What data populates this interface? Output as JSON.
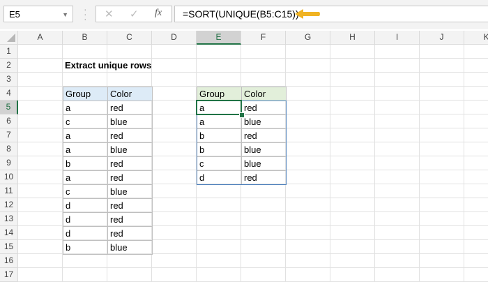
{
  "formula_bar": {
    "name_box": "E5",
    "cancel_icon": "✕",
    "enter_icon": "✓",
    "fx_label": "fx",
    "formula": "=SORT(UNIQUE(B5:C15))",
    "arrow_color": "#f0b323"
  },
  "columns": [
    "A",
    "B",
    "C",
    "D",
    "E",
    "F",
    "G",
    "H",
    "I",
    "J",
    "K"
  ],
  "rows": 17,
  "selected": {
    "col": "E",
    "row": 5
  },
  "title": "Extract unique rows",
  "source_table": {
    "headers": [
      "Group",
      "Color"
    ],
    "header_color": "#ddebf7",
    "rows": [
      [
        "a",
        "red"
      ],
      [
        "c",
        "blue"
      ],
      [
        "a",
        "red"
      ],
      [
        "a",
        "blue"
      ],
      [
        "b",
        "red"
      ],
      [
        "a",
        "red"
      ],
      [
        "c",
        "blue"
      ],
      [
        "d",
        "red"
      ],
      [
        "d",
        "red"
      ],
      [
        "d",
        "red"
      ],
      [
        "b",
        "blue"
      ]
    ]
  },
  "result_table": {
    "headers": [
      "Group",
      "Color"
    ],
    "header_color": "#e2efda",
    "rows": [
      [
        "a",
        "red"
      ],
      [
        "a",
        "blue"
      ],
      [
        "b",
        "red"
      ],
      [
        "b",
        "blue"
      ],
      [
        "c",
        "blue"
      ],
      [
        "d",
        "red"
      ]
    ]
  }
}
